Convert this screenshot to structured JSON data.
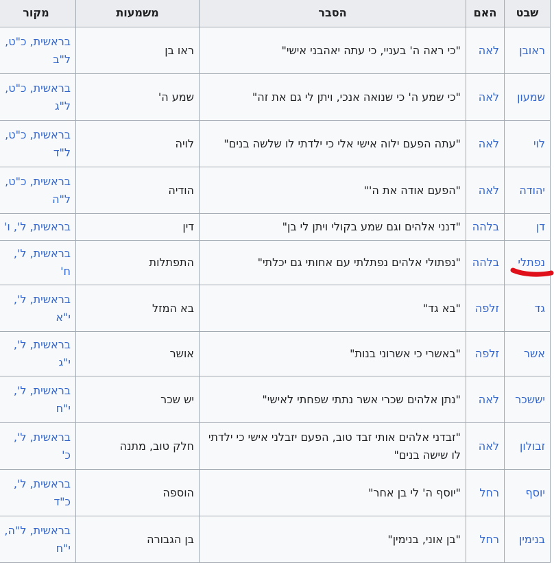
{
  "headers": {
    "tribe": "שבט",
    "mother": "האם",
    "explanation": "הסבר",
    "meaning": "משמעות",
    "source": "מקור"
  },
  "rows": [
    {
      "tribe": "ראובן",
      "mother": "לאה",
      "explanation": "\"כי ראה ה' בעניי, כי עתה יאהבני אישי\"",
      "meaning": "ראו בן",
      "source": "בראשית, כ\"ט, ל\"ב"
    },
    {
      "tribe": "שמעון",
      "mother": "לאה",
      "explanation": "\"כי שמע ה' כי שנואה אנכי, ויתן לי גם את זה\"",
      "meaning": "שמע ה'",
      "source": "בראשית, כ\"ט, ל\"ג"
    },
    {
      "tribe": "לוי",
      "mother": "לאה",
      "explanation": "\"עתה הפעם ילוה אישי אלי כי ילדתי לו שלשה בנים\"",
      "meaning": "לויה",
      "source": "בראשית, כ\"ט, ל\"ד"
    },
    {
      "tribe": "יהודה",
      "mother": "לאה",
      "explanation": "\"הפעם אודה את ה'\"",
      "meaning": "הודיה",
      "source": "בראשית, כ\"ט, ל\"ה"
    },
    {
      "tribe": "דן",
      "mother": "בלהה",
      "explanation": "\"דנני אלהים וגם שמע בקולי ויתן לי בן\"",
      "meaning": "דין",
      "source": "בראשית, ל', ו'"
    },
    {
      "tribe": "נפתלי",
      "mother": "בלהה",
      "explanation": "\"נפתולי אלהים נפתלתי עם אחותי גם יכלתי\"",
      "meaning": "התפתלות",
      "source": "בראשית, ל', ח'"
    },
    {
      "tribe": "גד",
      "mother": "זלפה",
      "explanation": "\"בא גד\"",
      "meaning": "בא המזל",
      "source": "בראשית, ל', י\"א"
    },
    {
      "tribe": "אשר",
      "mother": "זלפה",
      "explanation": "\"באשרי כי אשרוני בנות\"",
      "meaning": "אושר",
      "source": "בראשית, ל', י\"ג"
    },
    {
      "tribe": "יששכר",
      "mother": "לאה",
      "explanation": "\"נתן אלהים שכרי אשר נתתי שפחתי לאישי\"",
      "meaning": "יש שכר",
      "source": "בראשית, ל', י\"ח"
    },
    {
      "tribe": "זבולון",
      "mother": "לאה",
      "explanation": "\"זבדני אלהים אותי זבד טוב, הפעם יזבלני אישי כי ילדתי לו שישה בנים\"",
      "meaning": "חלק טוב, מתנה",
      "source": "בראשית, ל', כ'"
    },
    {
      "tribe": "יוסף",
      "mother": "רחל",
      "explanation": "\"יוסף ה' לי בן אחר\"",
      "meaning": "הוספה",
      "source": "בראשית, ל', כ\"ד"
    },
    {
      "tribe": "בנימין",
      "mother": "רחל",
      "explanation": "\"בן אוני, בנימין\"",
      "meaning": "בן הגבורה",
      "source": "בראשית, ל\"ה, י\"ח"
    }
  ],
  "colors": {
    "link": "#3366cc",
    "header_bg": "#eaecf0",
    "cell_bg": "#f8f9fa",
    "border": "#a2a9b1",
    "annotation": "#e0101a"
  }
}
